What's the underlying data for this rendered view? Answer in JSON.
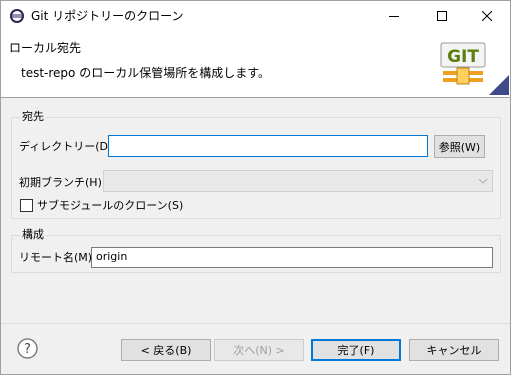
{
  "window": {
    "title": "Git リポジトリーのクローン"
  },
  "banner": {
    "title": "ローカル宛先",
    "description": "test-repo のローカル保管場所を構成します。",
    "logo_text": "GIT"
  },
  "destination_group": {
    "legend": "宛先",
    "directory_label": "ディレクトリー(D):",
    "directory_value": "",
    "browse_button": "参照(W)",
    "branch_label": "初期ブランチ(H):",
    "branch_value": "",
    "submodules_label": "サブモジュールのクローン(S)",
    "submodules_checked": false
  },
  "config_group": {
    "legend": "構成",
    "remote_label": "リモート名(M):",
    "remote_value": "origin"
  },
  "footer": {
    "back_button": "< 戻る(B)",
    "next_button": "次へ(N) >",
    "finish_button": "完了(F)",
    "cancel_button": "キャンセル"
  },
  "colors": {
    "accent": "#0078d7",
    "git_logo_green": "#6a8f1a",
    "git_logo_orange": "#f0a020"
  }
}
